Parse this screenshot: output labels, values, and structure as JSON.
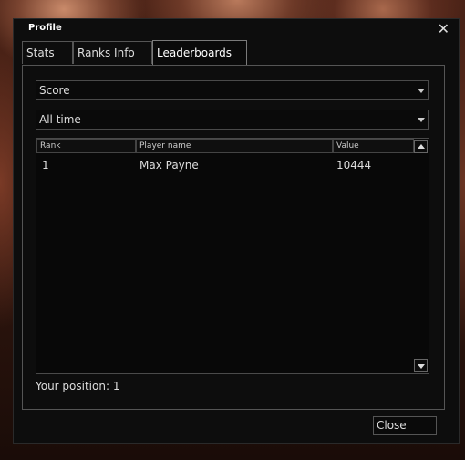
{
  "window": {
    "title": "Profile",
    "close_icon": "close-icon"
  },
  "tabs": [
    {
      "label": "Stats"
    },
    {
      "label": "Ranks Info"
    },
    {
      "label": "Leaderboards",
      "active": true
    }
  ],
  "filters": {
    "stat": {
      "value": "Score"
    },
    "period": {
      "value": "All time"
    }
  },
  "table": {
    "columns": [
      "Rank",
      "Player name",
      "Value"
    ],
    "rows": [
      {
        "rank": "1",
        "player": "Max Payne",
        "value": "10444"
      }
    ]
  },
  "footer": {
    "position_text": "Your position: 1",
    "close_label": "Close"
  },
  "colors": {
    "window_bg": "#0d0d0d",
    "border": "#555555",
    "text": "#dddddd"
  }
}
